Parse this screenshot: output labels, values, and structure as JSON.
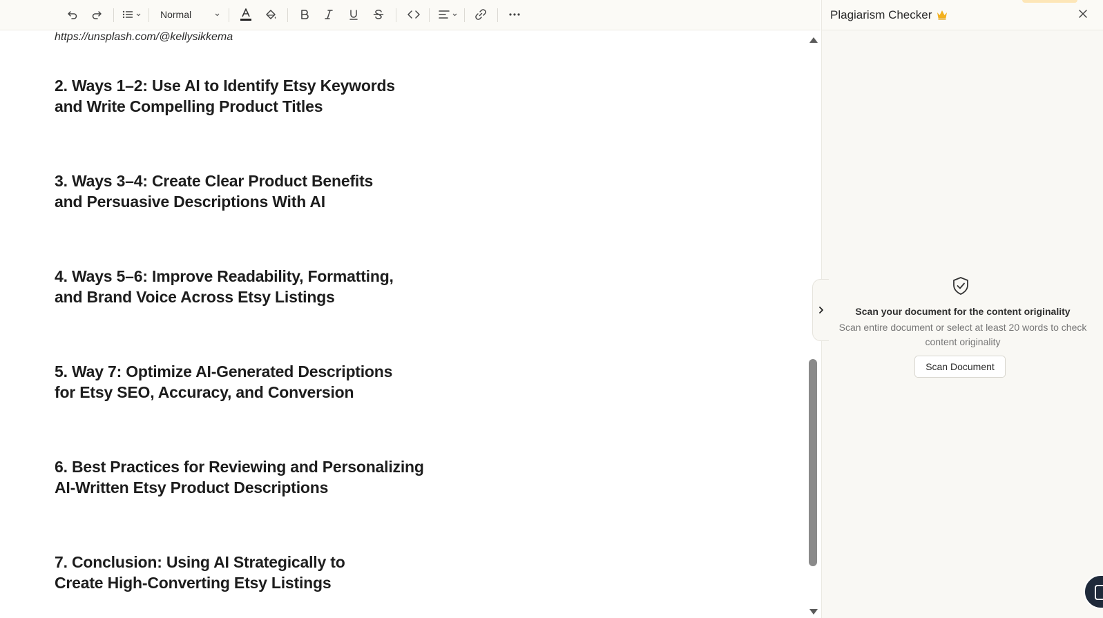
{
  "toolbar": {
    "style_select": "Normal",
    "icons": [
      "undo-icon",
      "redo-icon",
      "bulleted-list-icon",
      "text-color-icon",
      "highlight-icon",
      "bold-icon",
      "italic-icon",
      "underline-icon",
      "strikethrough-icon",
      "code-icon",
      "align-icon",
      "link-icon",
      "more-icon"
    ]
  },
  "document": {
    "link_text": "https://unsplash.com/@kellysikkema",
    "headings": [
      {
        "line1": "2. Ways 1–2: Use AI to Identify Etsy Keywords",
        "line2": "and Write Compelling Product Titles"
      },
      {
        "line1": "3. Ways 3–4: Create Clear Product Benefits",
        "line2": "and Persuasive Descriptions With AI"
      },
      {
        "line1": "4. Ways 5–6: Improve Readability, Formatting,",
        "line2": "and Brand Voice Across Etsy Listings"
      },
      {
        "line1": "5. Way 7: Optimize AI-Generated Descriptions",
        "line2": "for Etsy SEO, Accuracy, and Conversion"
      },
      {
        "line1": "6. Best Practices for Reviewing and Personalizing",
        "line2": "AI-Written Etsy Product Descriptions"
      },
      {
        "line1": "7. Conclusion: Using AI Strategically to",
        "line2": "Create High-Converting Etsy Listings"
      }
    ]
  },
  "panel": {
    "title": "Plagiarism Checker",
    "empty_title": "Scan your document for the content originality",
    "empty_desc": "Scan entire document or select at least 20 words to check content originality",
    "scan_button": "Scan Document"
  },
  "colors": {
    "crown": "#f2b01e",
    "panel_bg": "#f9f8f4",
    "toolbar_bg": "#fbfaf6",
    "scroll_thumb": "#8a8a8a"
  }
}
